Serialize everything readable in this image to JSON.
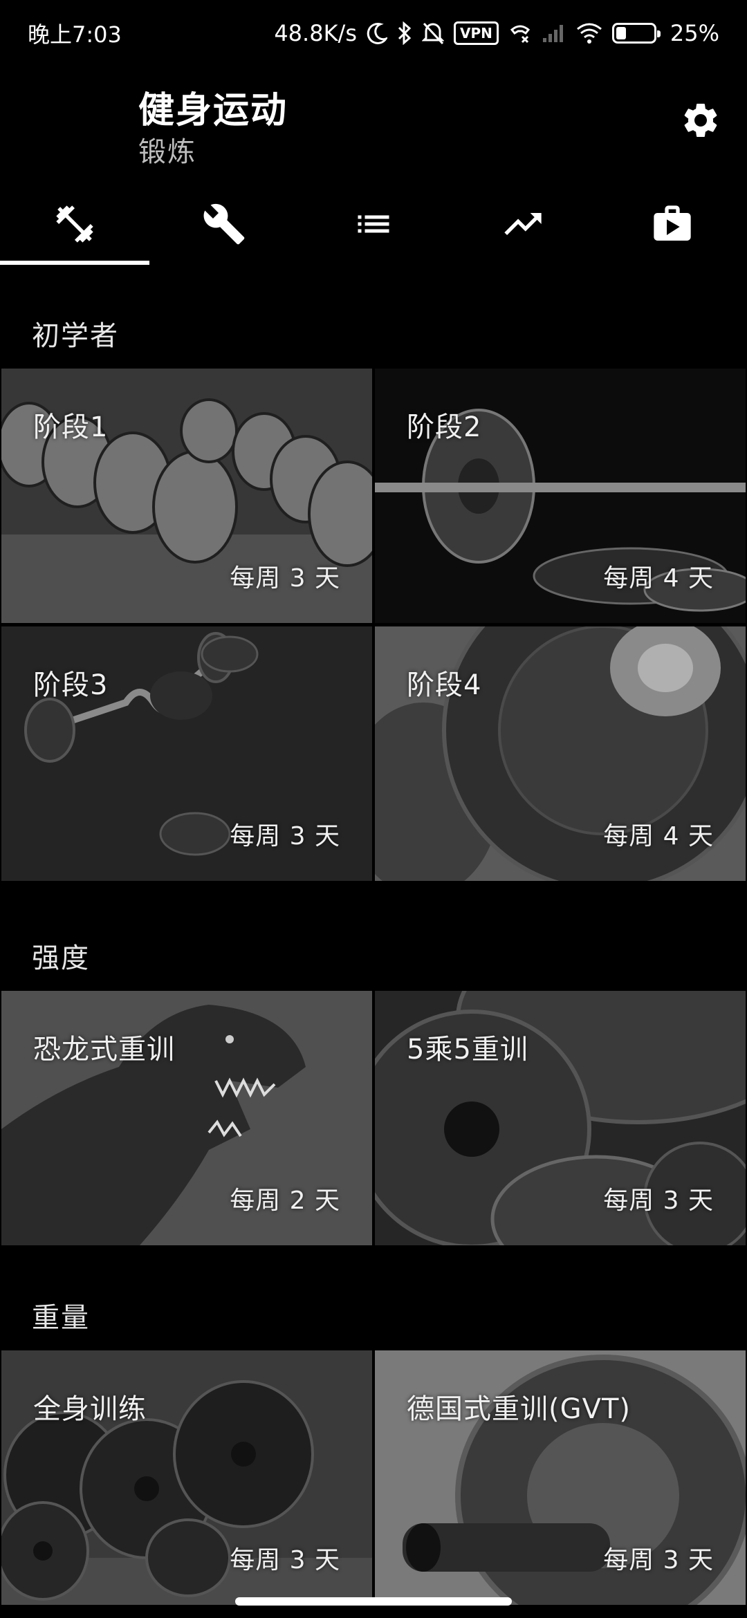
{
  "status_bar": {
    "time": "晚上7:03",
    "network_speed": "48.8K/s",
    "vpn_label": "VPN",
    "battery_percent": "25%",
    "battery_level": 0.25,
    "icons": [
      "moon-icon",
      "bluetooth-icon",
      "mute-icon",
      "vpn-icon",
      "call-forward-icon",
      "signal-icon",
      "wifi-icon",
      "battery-icon"
    ]
  },
  "header": {
    "title": "健身运动",
    "subtitle": "锻炼",
    "settings_icon": "gear-icon"
  },
  "tabs": [
    {
      "icon": "dumbbell-icon",
      "active": true
    },
    {
      "icon": "wrench-icon",
      "active": false
    },
    {
      "icon": "list-icon",
      "active": false
    },
    {
      "icon": "trending-up-icon",
      "active": false
    },
    {
      "icon": "video-bag-icon",
      "active": false
    }
  ],
  "sections": [
    {
      "title": "初学者",
      "cards": [
        {
          "name": "阶段1",
          "frequency": "每周 3 天"
        },
        {
          "name": "阶段2",
          "frequency": "每周 4 天"
        },
        {
          "name": "阶段3",
          "frequency": "每周 3 天"
        },
        {
          "name": "阶段4",
          "frequency": "每周 4 天"
        }
      ]
    },
    {
      "title": "强度",
      "cards": [
        {
          "name": "恐龙式重训",
          "frequency": "每周 2 天"
        },
        {
          "name": "5乘5重训",
          "frequency": "每周 3 天"
        }
      ]
    },
    {
      "title": "重量",
      "cards": [
        {
          "name": "全身训练",
          "frequency": "每周 3 天"
        },
        {
          "name": "德国式重训(GVT)",
          "frequency": "每周 3 天"
        }
      ]
    }
  ],
  "colors": {
    "background": "#000000",
    "text": "#ffffff",
    "subtitle": "#bdbdbd",
    "accent": "#ffffff"
  }
}
